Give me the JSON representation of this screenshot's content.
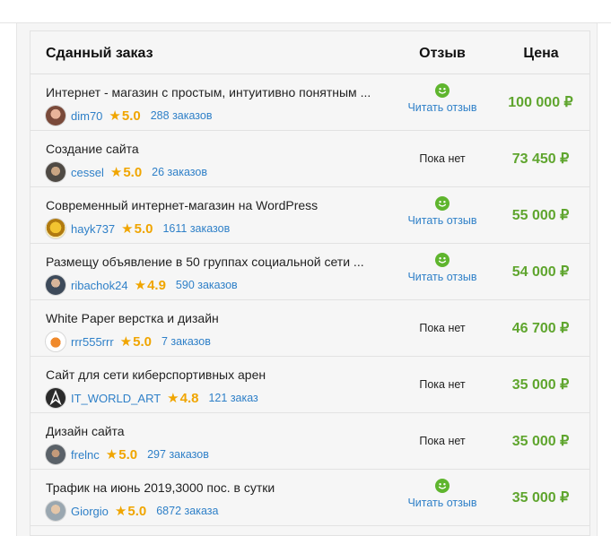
{
  "colors": {
    "accent": "#2f80c8",
    "rating": "#f0a500",
    "price": "#5fa52e",
    "positive": "#5fb52e"
  },
  "header": {
    "order": "Сданный заказ",
    "review": "Отзыв",
    "price": "Цена"
  },
  "rows": [
    {
      "title": "Интернет - магазин с простым, интуитивно понятным ...",
      "user": "dim70",
      "avatar": "avatar-photo",
      "star": "★",
      "rating": "5.0",
      "orders": "288 заказов",
      "has_review": true,
      "review": "Читать отзыв",
      "price": "100 000 ₽"
    },
    {
      "title": "Создание сайта",
      "user": "cessel",
      "avatar": "avatar-photo",
      "star": "★",
      "rating": "5.0",
      "orders": "26 заказов",
      "has_review": false,
      "review": "Пока нет",
      "price": "73 450 ₽"
    },
    {
      "title": "Современный интернет-магазин на WordPress",
      "user": "hayk737",
      "avatar": "avatar-emblem",
      "star": "★",
      "rating": "5.0",
      "orders": "1611 заказов",
      "has_review": true,
      "review": "Читать отзыв",
      "price": "55 000 ₽"
    },
    {
      "title": "Размещу объявление в 50 группах социальной сети ...",
      "user": "ribachok24",
      "avatar": "avatar-photo",
      "star": "★",
      "rating": "4.9",
      "orders": "590 заказов",
      "has_review": true,
      "review": "Читать отзыв",
      "price": "54 000 ₽"
    },
    {
      "title": "White Paper верстка и дизайн",
      "user": "rrr555rrr",
      "avatar": "avatar-fox",
      "star": "★",
      "rating": "5.0",
      "orders": "7 заказов",
      "has_review": false,
      "review": "Пока нет",
      "price": "46 700 ₽"
    },
    {
      "title": "Сайт для сети киберспортивных арен",
      "user": "IT_WORLD_ART",
      "avatar": "avatar-logo",
      "star": "★",
      "rating": "4.8",
      "orders": "121 заказ",
      "has_review": false,
      "review": "Пока нет",
      "price": "35 000 ₽"
    },
    {
      "title": "Дизайн сайта",
      "user": "frelnc",
      "avatar": "avatar-photo",
      "star": "★",
      "rating": "5.0",
      "orders": "297 заказов",
      "has_review": false,
      "review": "Пока нет",
      "price": "35 000 ₽"
    },
    {
      "title": "Трафик на июнь 2019,3000 пос. в сутки",
      "user": "Giorgio",
      "avatar": "avatar-photo",
      "star": "★",
      "rating": "5.0",
      "orders": "6872 заказа",
      "has_review": true,
      "review": "Читать отзыв",
      "price": "35 000 ₽"
    }
  ]
}
